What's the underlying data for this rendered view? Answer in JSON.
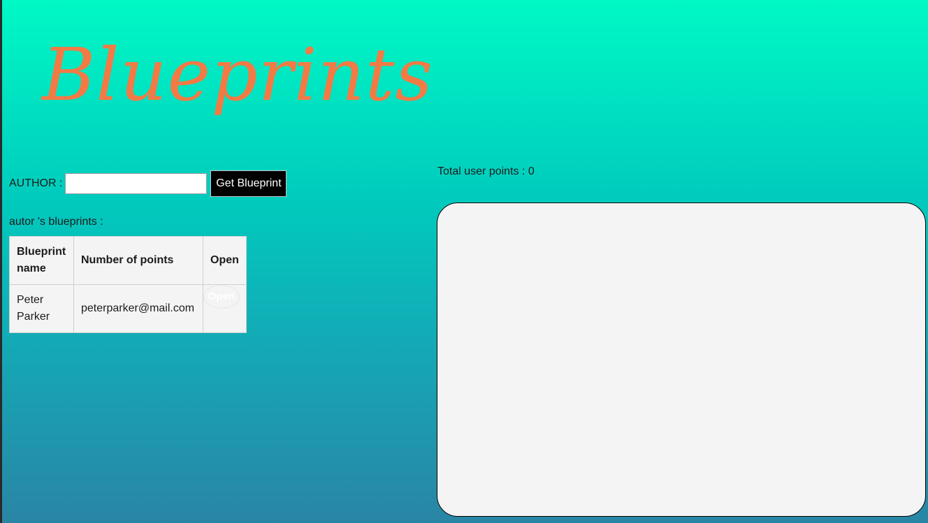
{
  "header": {
    "title": "Blueprints"
  },
  "search": {
    "author_label": "AUTHOR :",
    "author_value": "",
    "button_label": "Get Blueprint"
  },
  "blueprints_section": {
    "heading": "autor 's blueprints :",
    "columns": [
      "Blueprint name",
      "Number of points",
      "Open"
    ],
    "rows": [
      {
        "name": "Peter Parker",
        "points": "peterparker@mail.com",
        "open_label": "Open"
      }
    ]
  },
  "canvas_section": {
    "total_points_text": "Total user points : 0"
  },
  "colors": {
    "title": "#f27a45",
    "background_top": "#00f9c5",
    "background_bottom": "#2a85a5",
    "panel": "#f4f4f4",
    "button_dark": "#000000"
  }
}
